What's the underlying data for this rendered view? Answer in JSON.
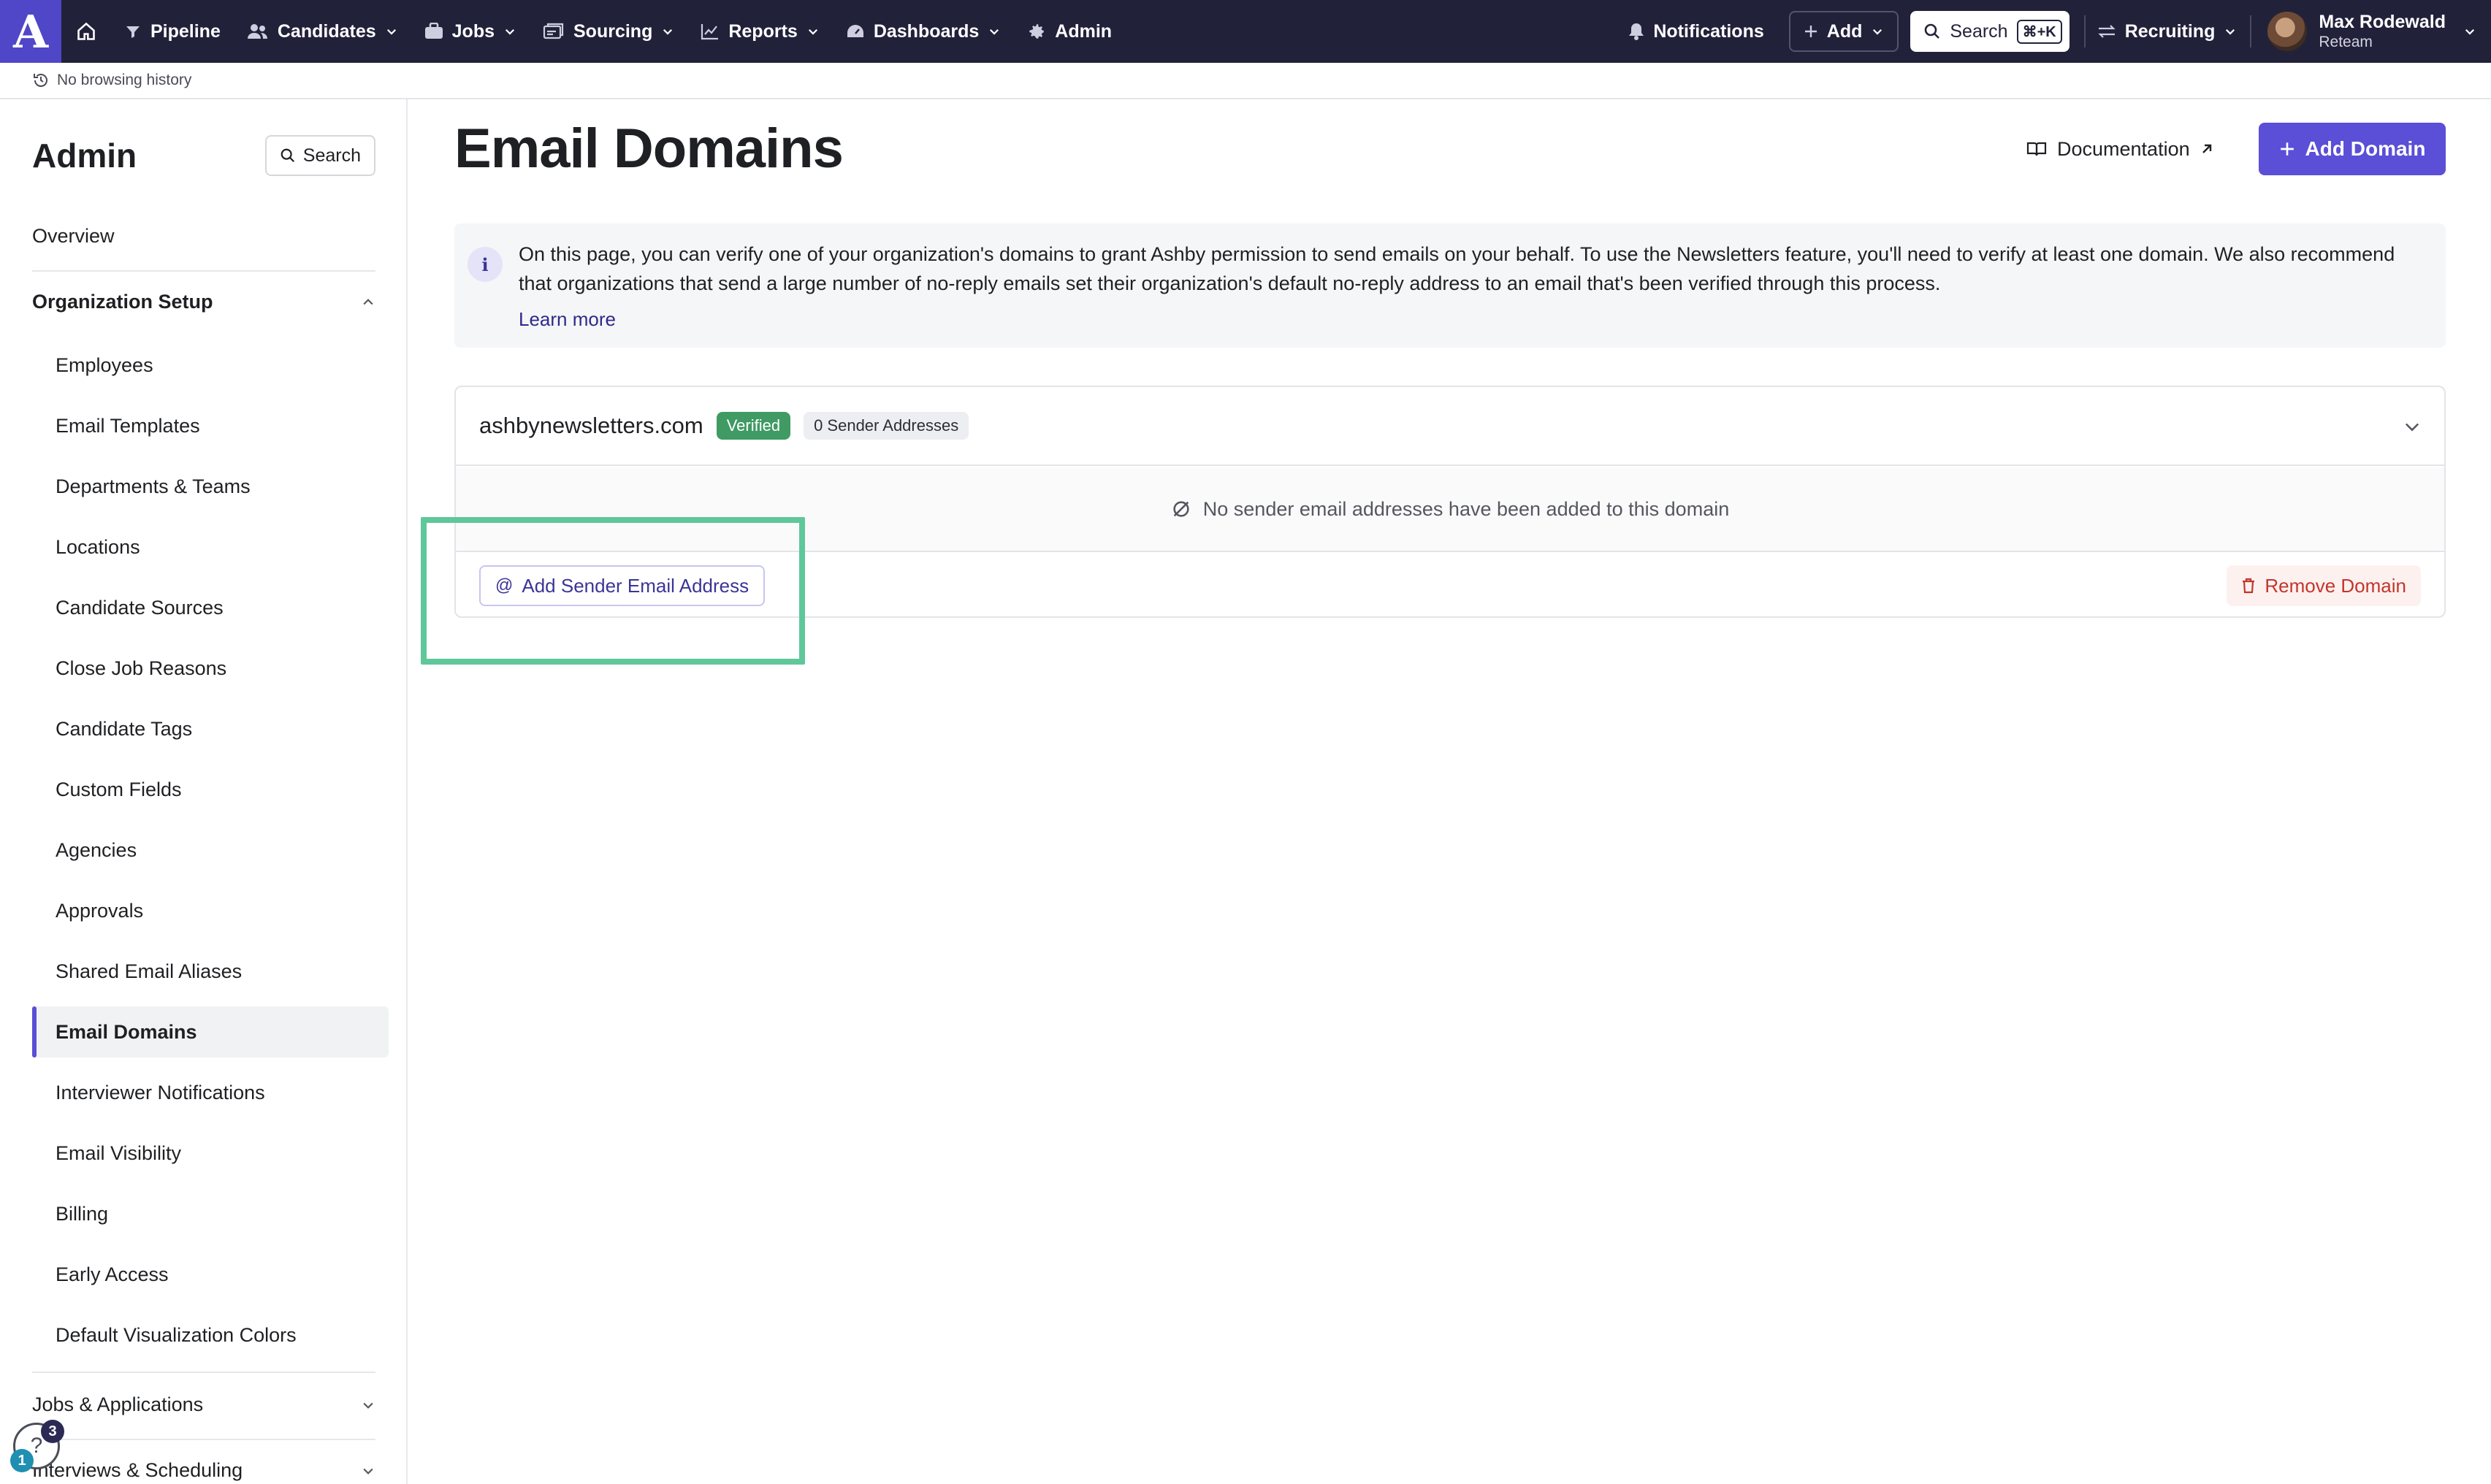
{
  "nav": {
    "logo": "A",
    "items": [
      {
        "label": "Pipeline",
        "icon": "filter-icon",
        "dropdown": false
      },
      {
        "label": "Candidates",
        "icon": "people-icon",
        "dropdown": true
      },
      {
        "label": "Jobs",
        "icon": "briefcase-icon",
        "dropdown": true
      },
      {
        "label": "Sourcing",
        "icon": "sourcing-icon",
        "dropdown": true
      },
      {
        "label": "Reports",
        "icon": "chart-icon",
        "dropdown": true
      },
      {
        "label": "Dashboards",
        "icon": "gauge-icon",
        "dropdown": true
      },
      {
        "label": "Admin",
        "icon": "gear-icon",
        "dropdown": false
      }
    ],
    "notifications": "Notifications",
    "add": "Add",
    "search": "Search",
    "search_shortcut": "⌘+K",
    "workspace": "Recruiting",
    "user_name": "Max Rodewald",
    "user_org": "Reteam"
  },
  "history": "No browsing history",
  "sidebar": {
    "title": "Admin",
    "search": "Search",
    "overview": "Overview",
    "section_setup": "Organization Setup",
    "items": [
      "Employees",
      "Email Templates",
      "Departments & Teams",
      "Locations",
      "Candidate Sources",
      "Close Job Reasons",
      "Candidate Tags",
      "Custom Fields",
      "Agencies",
      "Approvals",
      "Shared Email Aliases",
      "Email Domains",
      "Interviewer Notifications",
      "Email Visibility",
      "Billing",
      "Early Access",
      "Default Visualization Colors"
    ],
    "active_item": "Email Domains",
    "section_jobs": "Jobs & Applications",
    "section_interviews": "Interviews & Scheduling",
    "help_badge_count": "3",
    "help_badge_alert": "1"
  },
  "main": {
    "title": "Email Domains",
    "documentation": "Documentation",
    "add_domain": "Add Domain",
    "info_icon": "i",
    "info_text": "On this page, you can verify one of your organization's domains to grant Ashby permission to send emails on your behalf. To use the Newsletters feature, you'll need to verify at least one domain. We also recommend that organizations that send a large number of no-reply emails set their organization's default no-reply address to an email that's been verified through this process.",
    "learn_more": "Learn more",
    "domain": {
      "name": "ashbynewsletters.com",
      "status": "Verified",
      "sender_count": "0 Sender Addresses",
      "empty_message": "No sender email addresses have been added to this domain",
      "add_sender": "Add Sender Email Address",
      "remove": "Remove Domain"
    }
  },
  "colors": {
    "nav_bg": "#22213a",
    "brand": "#5a4fd6",
    "verified": "#3f9a63",
    "danger": "#c2362b",
    "highlight": "#5fc79a"
  }
}
